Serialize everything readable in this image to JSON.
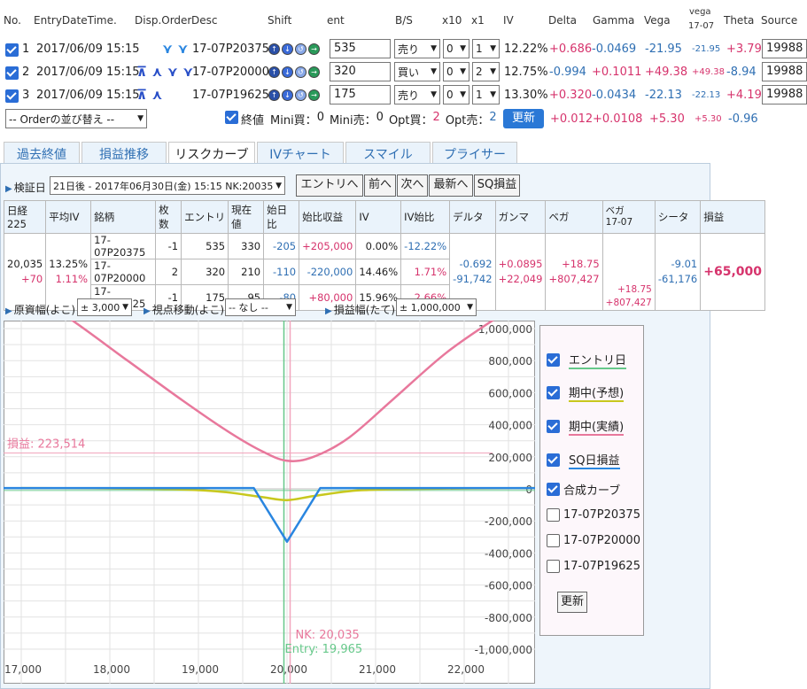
{
  "headers": {
    "no": "No.",
    "entry": "EntryDateTime.",
    "disp": "Disp.Order",
    "desc": "Desc",
    "shift": "Shift",
    "ent": "ent",
    "bs": "B/S",
    "x10": "x10",
    "x1": "x1",
    "iv": "IV",
    "delta": "Delta",
    "gamma": "Gamma",
    "vega": "Vega",
    "vega2a": "vega",
    "vega2b": "17-07",
    "theta": "Theta",
    "source": "Source"
  },
  "positions": [
    {
      "no": "1",
      "dt": "2017/06/09 15:15",
      "desc": "17-07P20375",
      "ent": "535",
      "bs": "売り",
      "x10": "0",
      "x1": "1",
      "iv": "12.22%",
      "delta": "+0.686",
      "gamma": "-0.0469",
      "vega": "-21.95",
      "vega2": "-21.95",
      "theta": "+3.79",
      "source": "19988"
    },
    {
      "no": "2",
      "dt": "2017/06/09 15:15",
      "desc": "17-07P20000",
      "ent": "320",
      "bs": "買い",
      "x10": "0",
      "x1": "2",
      "iv": "12.75%",
      "delta": "-0.994",
      "gamma": "+0.1011",
      "vega": "+49.38",
      "vega2": "+49.38",
      "theta": "-8.94",
      "source": "19988"
    },
    {
      "no": "3",
      "dt": "2017/06/09 15:15",
      "desc": "17-07P19625",
      "ent": "175",
      "bs": "売り",
      "x10": "0",
      "x1": "1",
      "iv": "13.30%",
      "delta": "+0.320",
      "gamma": "-0.0434",
      "vega": "-22.13",
      "vega2": "-22.13",
      "theta": "+4.19",
      "source": "19988"
    }
  ],
  "summary": {
    "order_select": "-- Orderの並び替え --",
    "close_label": "終値",
    "mini_buy_lbl": "Mini買：",
    "mini_buy": "0",
    "mini_sell_lbl": "Mini売：",
    "mini_sell": "0",
    "opt_buy_lbl": "Opt買：",
    "opt_buy": "2",
    "opt_sell_lbl": "Opt売：",
    "opt_sell": "2",
    "update": "更新",
    "delta": "+0.012",
    "gamma": "+0.0108",
    "vega": "+5.30",
    "vega2": "+5.30",
    "theta": "-0.96"
  },
  "tabs": [
    "過去終値",
    "損益推移",
    "リスクカーブ",
    "IVチャート",
    "スマイル",
    "プライサー"
  ],
  "verify": {
    "label": "検証日",
    "date": "21日後 - 2017年06月30日(金) 15:15 NK:20035",
    "btn_entry": "エントリへ",
    "btn_prev": "前へ",
    "btn_next": "次へ",
    "btn_latest": "最新へ",
    "btn_sq": "SQ損益"
  },
  "risk_table": {
    "headers": [
      "日経225",
      "平均IV",
      "銘柄",
      "枚数",
      "エントリ",
      "現在値",
      "始日比",
      "始比収益",
      "IV",
      "IV始比",
      "デルタ",
      "ガンマ",
      "ベガ",
      "ベガ",
      "シータ",
      "損益"
    ],
    "vega_sub": "17-07",
    "nk": "20,035",
    "nk_diff": "+70",
    "avg_iv": "13.25%",
    "avg_iv_diff": "1.11%",
    "rows": [
      {
        "name": "17-07P20375",
        "qty": "-1",
        "entry": "535",
        "now": "330",
        "diff": "-205",
        "pnl": "+205,000",
        "iv": "0.00%",
        "ivd": "-12.22%"
      },
      {
        "name": "17-07P20000",
        "qty": "2",
        "entry": "320",
        "now": "210",
        "diff": "-110",
        "pnl": "-220,000",
        "iv": "14.46%",
        "ivd": "1.71%"
      },
      {
        "name": "17-07P19625",
        "qty": "-1",
        "entry": "175",
        "now": "95",
        "diff": "-80",
        "pnl": "+80,000",
        "iv": "15.96%",
        "ivd": "2.66%"
      }
    ],
    "delta1": "-0.692",
    "delta2": "-91,742",
    "gamma1": "+0.0895",
    "gamma2": "+22,049",
    "vega1": "+18.75",
    "vega2": "+807,427",
    "vega17a": "+18.75",
    "vega17b": "+807,427",
    "theta1": "-9.01",
    "theta2": "-61,176",
    "pnl": "+65,000"
  },
  "controls": {
    "x_label": "原資幅(よこ)",
    "x_val": "± 3,000",
    "view_label": "視点移動(よこ)",
    "view_val": "-- なし --",
    "y_label": "損益幅(たて)",
    "y_val": "± 1,000,000"
  },
  "chart_data": {
    "type": "line",
    "xlim": [
      16800,
      22800
    ],
    "ylim": [
      -1050000,
      1050000
    ],
    "x_ticks": [
      "17,000",
      "18,000",
      "19,000",
      "20,000",
      "21,000",
      "22,000"
    ],
    "y_ticks": [
      "1,000,000",
      "800,000",
      "600,000",
      "400,000",
      "200,000",
      "0",
      "-200,000",
      "-400,000",
      "-600,000",
      "-800,000",
      "-1,000,000"
    ],
    "pnl_label": "損益: 223,514",
    "pnl_value": 223514,
    "nk_label": "NK: 20,035",
    "nk_value": 20035,
    "entry_label": "Entry: 19,965",
    "entry_value": 19965,
    "sq_curve": {
      "x": [
        16800,
        19625,
        20000,
        20375,
        22800
      ],
      "y": [
        5000,
        5000,
        -330000,
        5000,
        5000
      ]
    },
    "expected_curve": {
      "x": [
        17000,
        18500,
        19200,
        19700,
        20000,
        20300,
        20800,
        21500,
        22800
      ],
      "y": [
        5000,
        0,
        -15000,
        -50000,
        -70000,
        -45000,
        -10000,
        0,
        5000
      ]
    },
    "actual_curve": {
      "x": [
        16900,
        17500,
        18200,
        18800,
        19300,
        19700,
        20000,
        20300,
        20700,
        21200,
        21800,
        22400,
        22800
      ],
      "y": [
        1280000,
        1080000,
        800000,
        560000,
        370000,
        240000,
        175000,
        200000,
        320000,
        560000,
        850000,
        1080000,
        1220000
      ]
    }
  },
  "legend": {
    "entry_day": "エントリ日",
    "mid_expected": "期中(予想)",
    "mid_actual": "期中(実績)",
    "sq_pnl": "SQ日損益",
    "combined": "合成カーブ",
    "p1": "17-07P20375",
    "p2": "17-07P20000",
    "p3": "17-07P19625",
    "update": "更新"
  },
  "colors": {
    "sq": "#2a86e0",
    "expected": "#c8c81e",
    "actual": "#e8789c",
    "entry": "#66c88a"
  }
}
